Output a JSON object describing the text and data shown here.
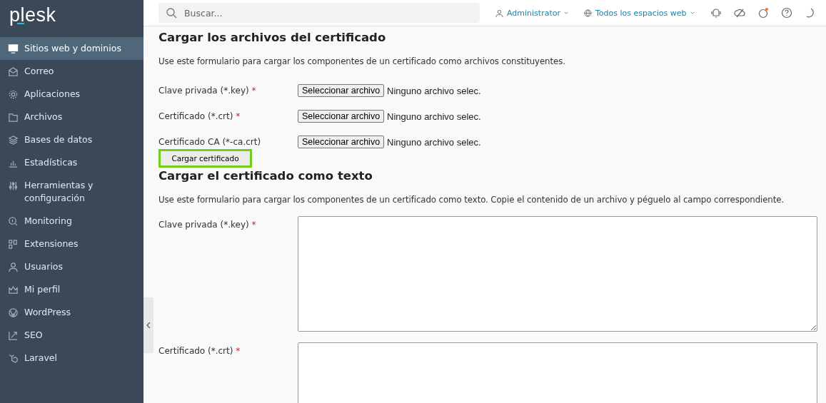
{
  "logo": "plesk",
  "sidebar": {
    "items": [
      {
        "label": "Sitios web y dominios",
        "selected": true
      },
      {
        "label": "Correo",
        "selected": false
      },
      {
        "label": "Aplicaciones",
        "selected": false
      },
      {
        "label": "Archivos",
        "selected": false
      },
      {
        "label": "Bases de datos",
        "selected": false
      },
      {
        "label": "Estadísticas",
        "selected": false
      },
      {
        "label": "Herramientas y configuración",
        "selected": false
      },
      {
        "label": "Monitoring",
        "selected": false
      },
      {
        "label": "Extensiones",
        "selected": false
      },
      {
        "label": "Usuarios",
        "selected": false
      },
      {
        "label": "Mi perfil",
        "selected": false
      },
      {
        "label": "WordPress",
        "selected": false
      },
      {
        "label": "SEO",
        "selected": false
      },
      {
        "label": "Laravel",
        "selected": false
      }
    ]
  },
  "header": {
    "search": {
      "placeholder": "Buscar..."
    },
    "user": "Administrator",
    "scope": "Todos los espacios web"
  },
  "file_section": {
    "title": "Cargar los archivos del certificado",
    "description": "Use este formulario para cargar los componentes de un certificado como archivos constituyentes.",
    "fields": [
      {
        "label": "Clave privada (*.key)",
        "mark": "*",
        "button": "Seleccionar archivo",
        "status": "Ninguno archivo selec."
      },
      {
        "label": "Certificado (*.crt)",
        "mark": "*",
        "button": "Seleccionar archivo",
        "status": "Ninguno archivo selec."
      },
      {
        "label": "Certificado CA (*-ca.crt)",
        "button": "Seleccionar archivo",
        "status": "Ninguno archivo selec."
      }
    ],
    "submit": "Cargar certificado"
  },
  "text_section": {
    "title": "Cargar el certificado como texto",
    "description": "Use este formulario para cargar los componentes de un certificado como texto. Copie el contenido de un archivo y péguelo al campo correspondiente.",
    "fields": [
      {
        "label": "Clave privada (*.key)",
        "mark": "*"
      },
      {
        "label": "Certificado (*.crt)",
        "mark": "*"
      }
    ]
  }
}
